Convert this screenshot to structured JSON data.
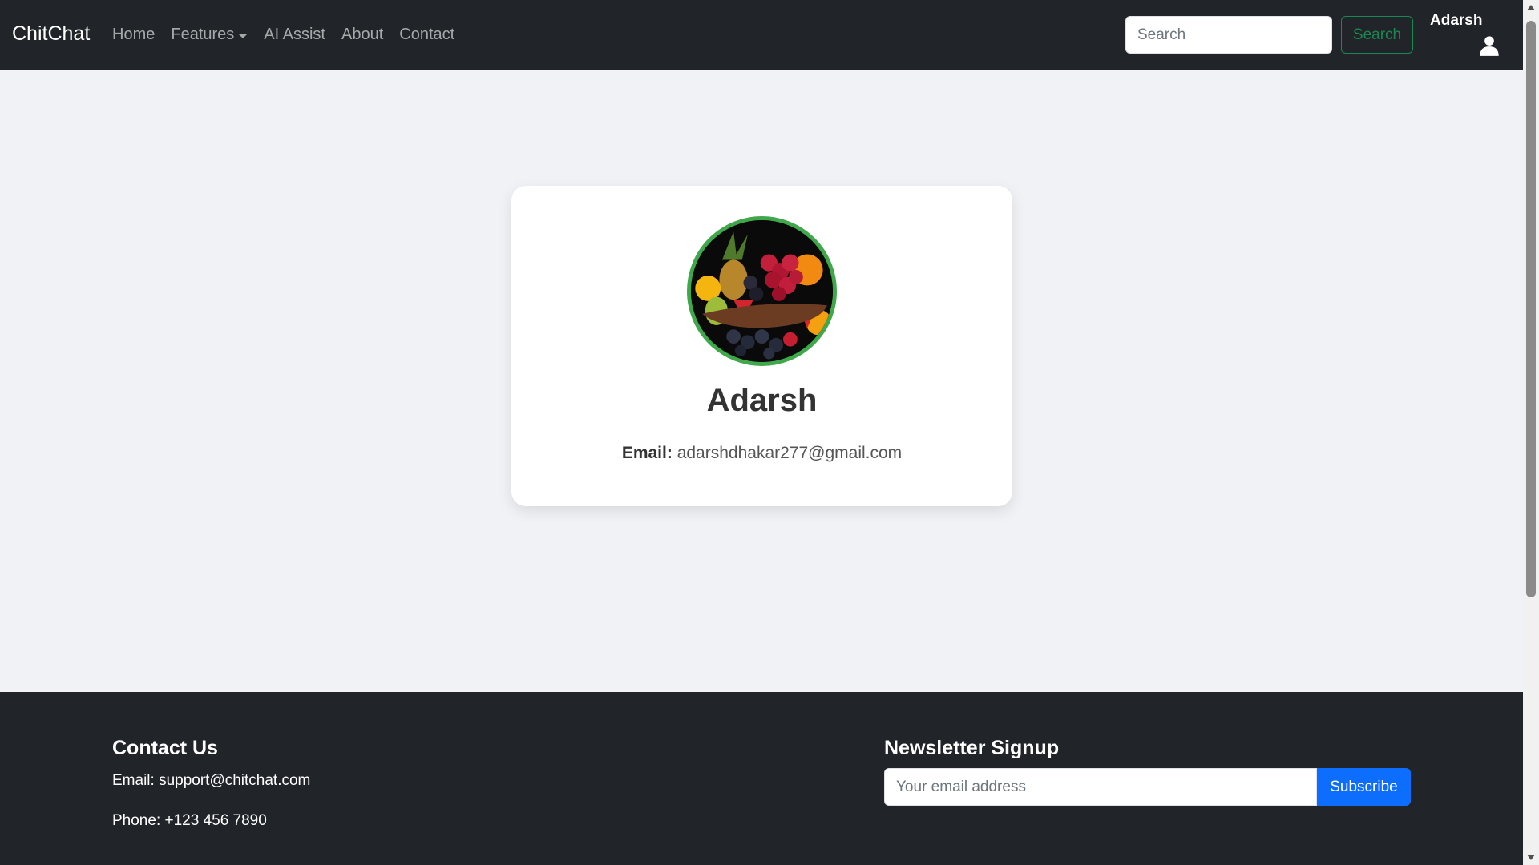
{
  "navbar": {
    "brand": "ChitChat",
    "links": [
      {
        "label": "Home"
      },
      {
        "label": "Features"
      },
      {
        "label": "AI Assist"
      },
      {
        "label": "About"
      },
      {
        "label": "Contact"
      }
    ],
    "search_placeholder": "Search",
    "search_button": "Search",
    "user_name": "Adarsh",
    "user_icon": "user-icon"
  },
  "profile": {
    "name": "Adarsh",
    "email_label": "Email:",
    "email_value": "adarshdhakar277@gmail.com",
    "avatar_icon": "fruit-basket-photo"
  },
  "footer": {
    "contact_title": "Contact Us",
    "contact_email": "Email: support@chitchat.com",
    "contact_phone": "Phone: +123 456 7890",
    "newsletter_title": "Newsletter Signup",
    "newsletter_placeholder": "Your email address",
    "subscribe_button": "Subscribe"
  },
  "colors": {
    "navbar_bg": "#212529",
    "page_bg": "#f0f2f5",
    "success": "#198754",
    "primary": "#0d6efd",
    "avatar_border": "#3fa84a"
  }
}
